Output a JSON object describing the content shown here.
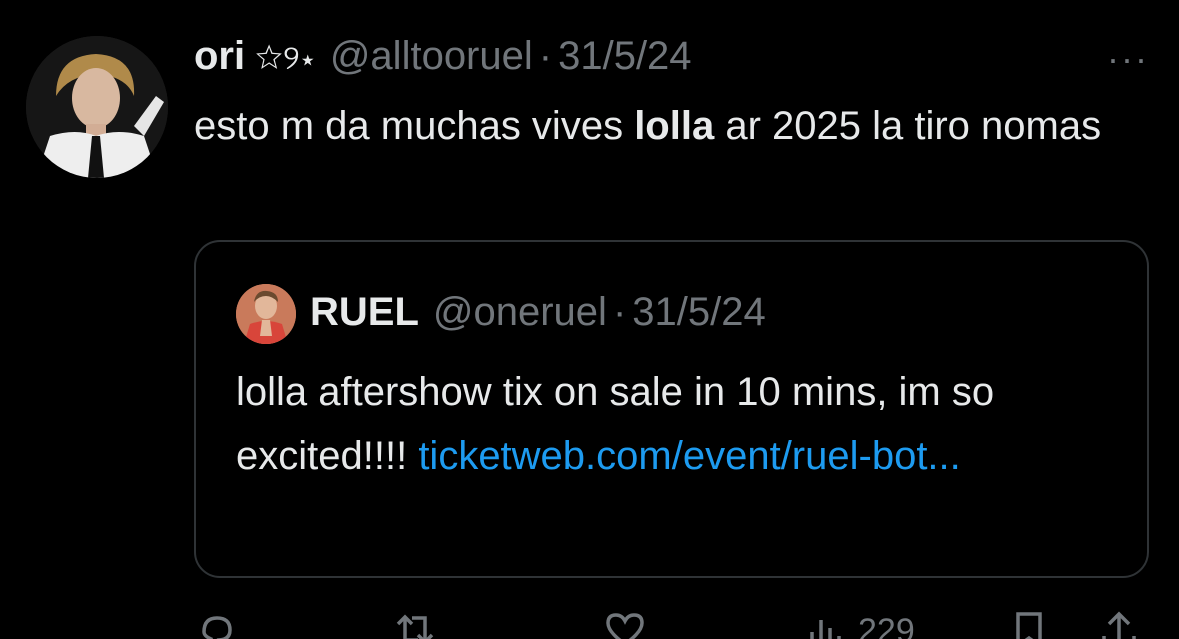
{
  "tweet": {
    "author_name": "ori",
    "author_deco": "☆୨⋆",
    "handle": "@alltooruel",
    "separator": "·",
    "date": "31/5/24",
    "more_icon": "···",
    "text_part1": "esto m da muchas vives ",
    "text_bold": "lolla",
    "text_part2": " ar 2025 la tiro nomas"
  },
  "quoted": {
    "author_name": "RUEL",
    "handle": "@oneruel",
    "separator": "·",
    "date": "31/5/24",
    "text": "lolla aftershow tix on sale in 10 mins, im so excited!!!! ",
    "link": "ticketweb.com/event/ruel-bot..."
  },
  "actions": {
    "reply_icon": "reply-icon",
    "retweet_icon": "retweet-icon",
    "like_icon": "like-icon",
    "views_icon": "views-icon",
    "views_count": "229",
    "bookmark_icon": "bookmark-icon",
    "share_icon": "share-icon"
  },
  "colors": {
    "background": "#000000",
    "text": "#e7e9ea",
    "muted": "#71767b",
    "link": "#1d9bf0",
    "border": "#2f3336"
  }
}
